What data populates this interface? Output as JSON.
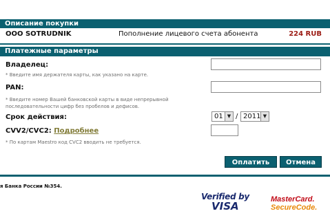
{
  "purchase": {
    "header": "Описание покупки",
    "merchant": "OOO SOTRUDNIK",
    "description": "Пополнение лицевого счета абонента",
    "amount": "224 RUB"
  },
  "payment": {
    "header": "Платежные параметры",
    "owner_label": "Владелец:",
    "owner_value": "",
    "owner_hint": "* Введите имя держателя карты, как указано на карте.",
    "pan_label": "PAN:",
    "pan_value": "",
    "pan_hint_line1": "* Введите номер Вашей банковской карты в виде непрерывной",
    "pan_hint_line2": "последовательности цифр без пробелов и дефисов.",
    "expiry_label": "Срок действия:",
    "expiry_month": "01",
    "expiry_separator": "/",
    "expiry_year": "2011",
    "cvv_label": "CVV2/CVC2:",
    "cvv_link": "Подробнее",
    "cvv_value": "",
    "cvv_hint": "* По картам Maestro код CVC2 вводить не требуется."
  },
  "buttons": {
    "pay": "Оплатить",
    "cancel": "Отмена"
  },
  "footer": {
    "text": "я Банка России №354.",
    "verified_by_visa_line1": "Verified by",
    "verified_by_visa_line2": "VISA",
    "mastercard_line1": "MasterCard.",
    "mastercard_line2": "SecureCode."
  },
  "colors": {
    "accent": "#0b6070",
    "amount": "#9b1b14",
    "link": "#807a35",
    "hint": "#6e6e6e"
  },
  "icons": {
    "dropdown": "dropdown-arrow-icon"
  }
}
